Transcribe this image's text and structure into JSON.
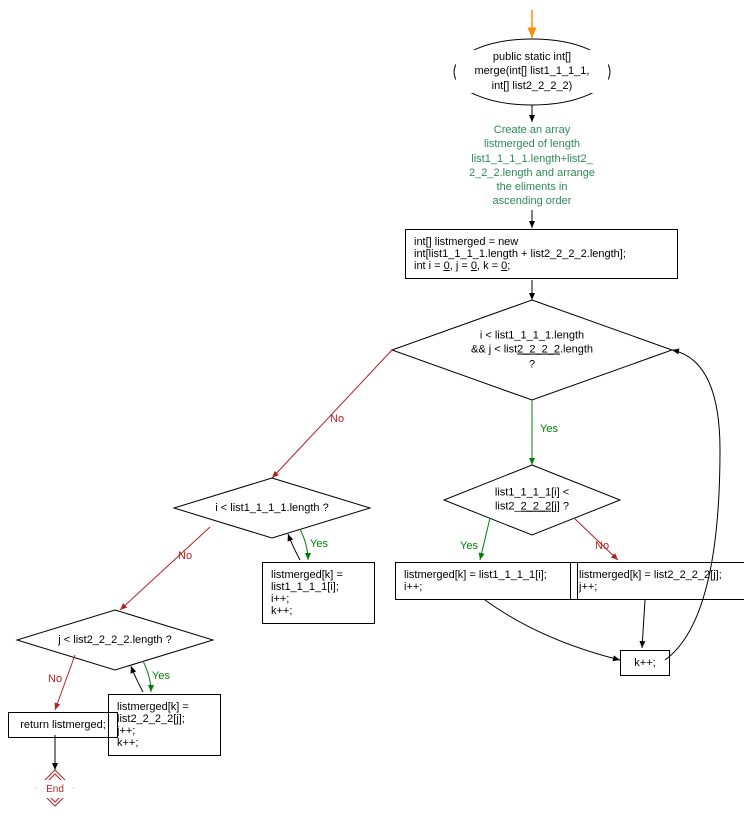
{
  "chart_data": {
    "type": "flowchart",
    "nodes": [
      {
        "id": "start",
        "type": "terminator",
        "label": "public static int[] merge(int[] list1_1_1_1, int[] list2_2_2_2)"
      },
      {
        "id": "comment",
        "type": "comment",
        "label": "Create an array listmerged of length list1_1_1_1.length+list2_2_2_2.length and arrange the eliments in ascending order"
      },
      {
        "id": "init",
        "type": "process",
        "label": "int[] listmerged = new int[list1_1_1_1.length + list2_2_2_2.length]; int i = 0, j = 0, k = 0;"
      },
      {
        "id": "cond1",
        "type": "decision",
        "label": "i < list1_1_1_1.length && j < list2_2_2_2.length ?"
      },
      {
        "id": "cond2",
        "type": "decision",
        "label": "list1_1_1_1[i] < list2_2_2_2[j] ?"
      },
      {
        "id": "assignI",
        "type": "process",
        "label": "listmerged[k] = list1_1_1_1[i]; i++;"
      },
      {
        "id": "assignJ",
        "type": "process",
        "label": "listmerged[k] = list2_2_2_2[j]; j++;"
      },
      {
        "id": "kpp",
        "type": "process",
        "label": "k++;"
      },
      {
        "id": "cond3",
        "type": "decision",
        "label": "i < list1_1_1_1.length ?"
      },
      {
        "id": "loop1",
        "type": "process",
        "label": "listmerged[k] = list1_1_1_1[i]; i++; k++;"
      },
      {
        "id": "cond4",
        "type": "decision",
        "label": "j < list2_2_2_2.length ?"
      },
      {
        "id": "loop2",
        "type": "process",
        "label": "listmerged[k] = list2_2_2_2[j]; j++; k++;"
      },
      {
        "id": "return",
        "type": "process",
        "label": "return listmerged;"
      },
      {
        "id": "end",
        "type": "end",
        "label": "End"
      }
    ],
    "edges": [
      {
        "from": "start",
        "to": "comment"
      },
      {
        "from": "comment",
        "to": "init"
      },
      {
        "from": "init",
        "to": "cond1"
      },
      {
        "from": "cond1",
        "to": "cond2",
        "label": "Yes"
      },
      {
        "from": "cond1",
        "to": "cond3",
        "label": "No"
      },
      {
        "from": "cond2",
        "to": "assignI",
        "label": "Yes"
      },
      {
        "from": "cond2",
        "to": "assignJ",
        "label": "No"
      },
      {
        "from": "assignI",
        "to": "kpp"
      },
      {
        "from": "assignJ",
        "to": "kpp"
      },
      {
        "from": "kpp",
        "to": "cond1"
      },
      {
        "from": "cond3",
        "to": "loop1",
        "label": "Yes"
      },
      {
        "from": "loop1",
        "to": "cond3"
      },
      {
        "from": "cond3",
        "to": "cond4",
        "label": "No"
      },
      {
        "from": "cond4",
        "to": "loop2",
        "label": "Yes"
      },
      {
        "from": "loop2",
        "to": "cond4"
      },
      {
        "from": "cond4",
        "to": "return",
        "label": "No"
      },
      {
        "from": "return",
        "to": "end"
      }
    ]
  },
  "labels": {
    "yes": "Yes",
    "no": "No",
    "end": "End",
    "return": "return listmerged;",
    "start_l1": "public static int[]",
    "start_l2": "merge(int[] list1_1_1_1,",
    "start_l3": "int[] list2_2_2_2)",
    "comment_l1": "Create an array",
    "comment_l2": "listmerged of length",
    "comment_l3": "list1_1_1_1.length+list2_",
    "comment_l4": "2_2_2.length and arrange",
    "comment_l5": "the eliments in",
    "comment_l6": "ascending order",
    "init_l1": "int[] listmerged = new",
    "init_l2a": "int[list1_1_1_1.length + list2_2_2_2.length];",
    "init_l3a": "int i = ",
    "init_l3b": "0",
    "init_l3c": ", j = ",
    "init_l3d": "0",
    "init_l3e": ", k = ",
    "init_l3f": "0",
    "init_l3g": ";",
    "cond1_l1": "i < list1_1_1_1.length",
    "cond1_l2a": "&& j < list",
    "cond1_l2b": "2_2_2_2",
    "cond1_l2c": ".length",
    "cond1_l3": "?",
    "cond2_l1": "list1_1_1_1[i] <",
    "cond2_l2a": "list2_",
    "cond2_l2b": "2_2_2",
    "cond2_l2c": "[j] ?",
    "assignI_l1": "listmerged[k] = list1_1_1_1[i];",
    "assignI_l2": "i++;",
    "assignJ_l1": "listmerged[k] = list2_2_2_2[j];",
    "assignJ_l2": "j++;",
    "kpp": "k++;",
    "cond3": "i < list1_1_1_1.length ?",
    "loop1_l1": "listmerged[k] =",
    "loop1_l2": "list1_1_1_1[i];",
    "loop1_l3": "i++;",
    "loop1_l4": "k++;",
    "cond4": "j < list2_2_2_2.length ?",
    "loop2_l1": "listmerged[k] =",
    "loop2_l2": "list2_2_2_2[j];",
    "loop2_l3": "j++;",
    "loop2_l4": "k++;"
  }
}
